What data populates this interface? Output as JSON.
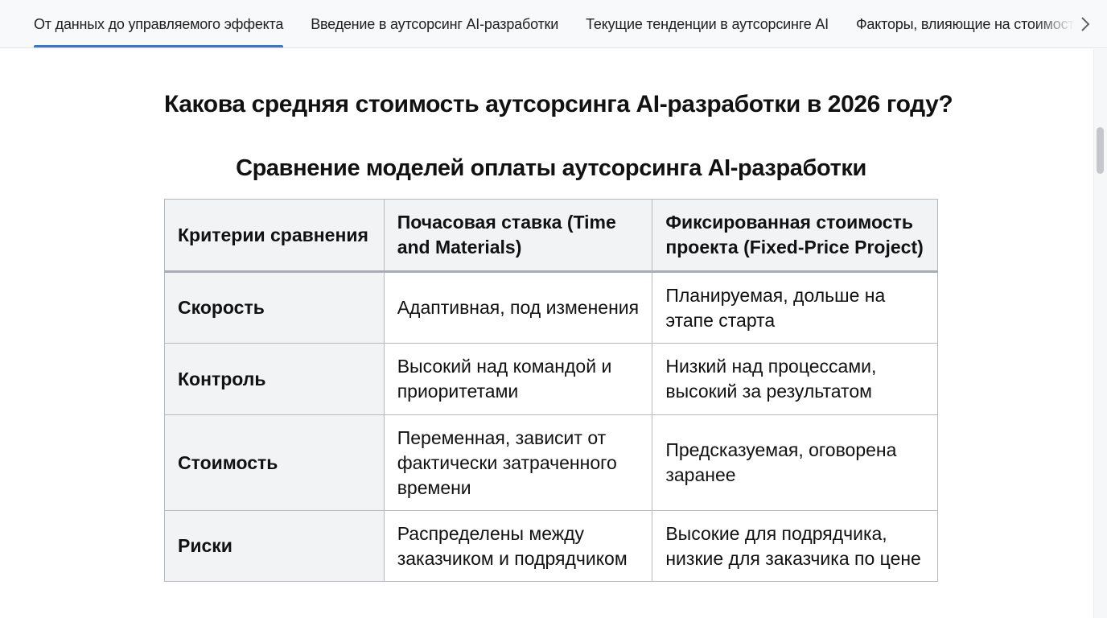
{
  "tabs": [
    {
      "label": "От данных до управляемого эффекта",
      "active": true
    },
    {
      "label": "Введение в аутсорсинг AI-разработки",
      "active": false
    },
    {
      "label": "Текущие тенденции в аутсорсинге AI",
      "active": false
    },
    {
      "label": "Факторы, влияющие на стоимость",
      "active": false
    }
  ],
  "tab_next_icon": "chevron-right-icon",
  "accent_color": "#3a74d0",
  "heading": "Какова средняя стоимость аутсорсинга AI-разработки в 2026 году?",
  "table": {
    "title": "Сравнение моделей оплаты аутсорсинга AI-разработки",
    "headers": [
      "Критерии сравнения",
      "Почасовая ставка (Time and Materials)",
      "Фиксированная стоимость проекта (Fixed-Price Project)"
    ],
    "rows": [
      [
        "Скорость",
        "Адаптивная, под изменения",
        "Планируемая, дольше на этапе старта"
      ],
      [
        "Контроль",
        "Высокий над командой и приоритетами",
        "Низкий над процессами, высокий за результатом"
      ],
      [
        "Стоимость",
        "Переменная, зависит от фактически затраченного времени",
        "Предсказуемая, оговорена заранее"
      ],
      [
        "Риски",
        "Распределены между заказчиком и подрядчиком",
        "Высокие для подрядчика, низкие для заказчика по цене"
      ]
    ]
  }
}
